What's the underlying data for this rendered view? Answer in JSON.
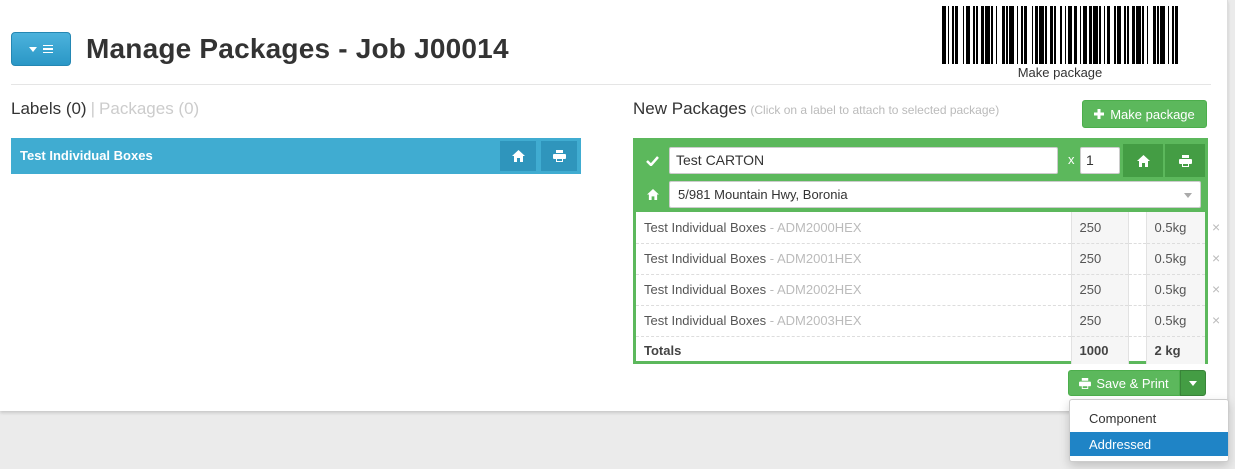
{
  "header": {
    "title": "Manage Packages - Job J00014",
    "menu_icon": "list-icon",
    "barcode_caption": "Make package"
  },
  "left": {
    "tab_labels": "Labels (0)",
    "tab_separator": "|",
    "tab_packages": "Packages (0)",
    "label_item": "Test Individual Boxes"
  },
  "right": {
    "title": "New Packages",
    "hint": "(Click on a label to attach to selected package)",
    "make_package_label": "Make package",
    "package": {
      "name": "Test CARTON",
      "quantity_prefix": "x",
      "quantity": "1",
      "address": "5/981 Mountain Hwy, Boronia",
      "items": [
        {
          "name": "Test Individual Boxes",
          "sep": " - ",
          "code": "ADM2000HEX",
          "qty": "250",
          "weight": "0.5kg"
        },
        {
          "name": "Test Individual Boxes",
          "sep": " - ",
          "code": "ADM2001HEX",
          "qty": "250",
          "weight": "0.5kg"
        },
        {
          "name": "Test Individual Boxes",
          "sep": " - ",
          "code": "ADM2002HEX",
          "qty": "250",
          "weight": "0.5kg"
        },
        {
          "name": "Test Individual Boxes",
          "sep": " - ",
          "code": "ADM2003HEX",
          "qty": "250",
          "weight": "0.5kg"
        }
      ],
      "totals_label": "Totals",
      "total_qty": "1000",
      "total_weight": "2 kg",
      "remove_glyph": "×"
    },
    "save_print_label": "Save & Print",
    "dropdown": {
      "options": [
        "Component",
        "Addressed"
      ],
      "selected": "Addressed"
    }
  },
  "colors": {
    "brand_blue": "#40acd1",
    "success_green": "#5cb85c",
    "selected_blue": "#1f84c6"
  }
}
